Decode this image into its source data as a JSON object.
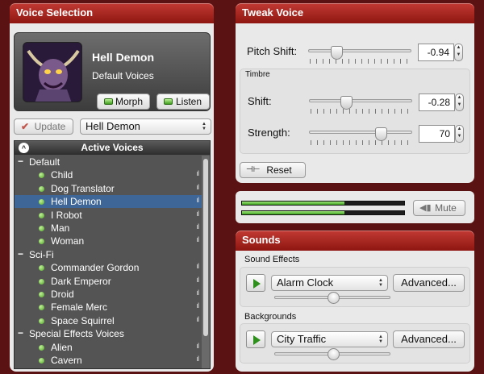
{
  "voice_selection": {
    "tab_title": "Voice Selection",
    "voice_name": "Hell Demon",
    "voice_pack": "Default Voices",
    "morph_label": "Morph",
    "listen_label": "Listen",
    "update_label": "Update",
    "voice_dropdown": "Hell Demon",
    "active_voices_title": "Active Voices",
    "collapse_icon": "^",
    "categories": [
      {
        "label": "Default",
        "toggle": "−"
      },
      {
        "label": "Sci-Fi",
        "toggle": "−"
      },
      {
        "label": "Special Effects Voices",
        "toggle": "−"
      }
    ],
    "voices": [
      "Child",
      "Dog Translator",
      "Hell Demon",
      "I Robot",
      "Man",
      "Woman",
      "Commander Gordon",
      "Dark Emperor",
      "Droid",
      "Female Merc",
      "Space Squirrel",
      "Alien",
      "Cavern"
    ],
    "selected_voice": "Hell Demon",
    "signal_glyph": "ıl"
  },
  "tweak_voice": {
    "tab_title": "Tweak Voice",
    "pitch_shift_label": "Pitch Shift:",
    "pitch_shift_value": "-0.94",
    "timbre_title": "Timbre",
    "shift_label": "Shift:",
    "shift_value": "-0.28",
    "strength_label": "Strength:",
    "strength_value": "70",
    "pitch_level": 0.28,
    "shift_level": 0.36,
    "strength_level": 0.7,
    "reset_label": "Reset",
    "reset_icon": "⊣⊢"
  },
  "levels": {
    "mute_label": "Mute",
    "meter_top": 0.63,
    "meter_bottom": 0.63
  },
  "sounds": {
    "tab_title": "Sounds",
    "sound_effects_title": "Sound Effects",
    "sound_effect_selected": "Alarm Clock",
    "advanced_label": "Advanced...",
    "backgrounds_title": "Backgrounds",
    "background_selected": "City Traffic",
    "effects_volume": 0.51,
    "background_volume": 0.51
  },
  "colors": {
    "frame": "#5b1212",
    "tab_red": "#a8251e",
    "selection_blue": "#3e6697",
    "meter_green": "#5fc83b"
  }
}
